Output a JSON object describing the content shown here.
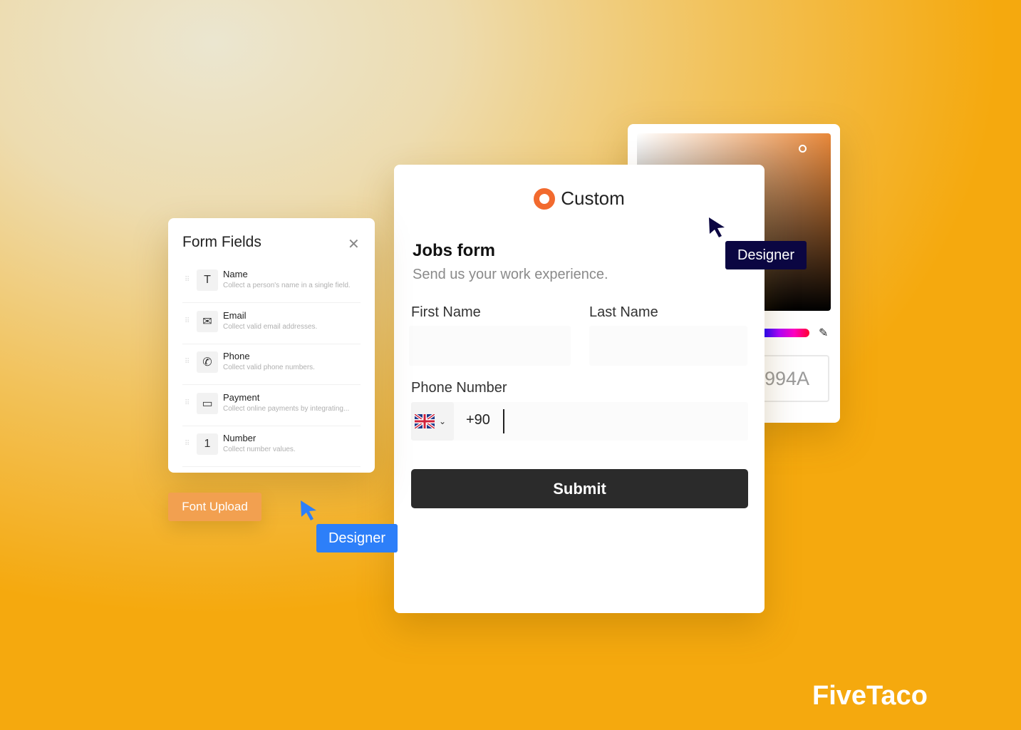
{
  "color_picker": {
    "hex_value": "994A",
    "hue_colors": [
      "#00c8ff",
      "#ff0030"
    ],
    "selected_color": "#e8883a"
  },
  "main_form": {
    "brand": "Custom",
    "brand_color": "#f26a2e",
    "title": "Jobs form",
    "subtitle": "Send us your work experience.",
    "first_name_label": "First Name",
    "last_name_label": "Last Name",
    "phone_label": "Phone Number",
    "country_flag": "uk-flag",
    "phone_prefix": "+90",
    "submit_label": "Submit"
  },
  "form_fields": {
    "title": "Form Fields",
    "items": [
      {
        "label": "Name",
        "desc": "Collect a person's name in a single field.",
        "icon": "T"
      },
      {
        "label": "Email",
        "desc": "Collect valid email addresses.",
        "icon": "✉"
      },
      {
        "label": "Phone",
        "desc": "Collect valid phone numbers.",
        "icon": "✆"
      },
      {
        "label": "Payment",
        "desc": "Collect online payments by integrating...",
        "icon": "▭"
      },
      {
        "label": "Number",
        "desc": "Collect number values.",
        "icon": "1"
      }
    ]
  },
  "font_upload_label": "Font Upload",
  "cursor_tags": {
    "blue": "Designer",
    "dark": "Designer"
  },
  "logo": "FiveTaco"
}
